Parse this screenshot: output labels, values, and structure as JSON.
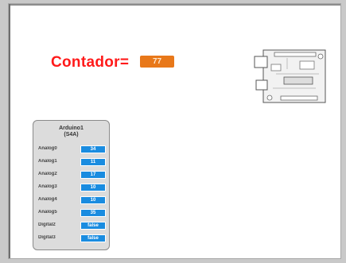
{
  "stage": {
    "counter": {
      "label": "Contador=",
      "value": "77"
    }
  },
  "arduino_panel": {
    "title_line1": "Arduino1",
    "title_line2": "(S4A)",
    "rows": [
      {
        "label": "Analog0",
        "value": "34",
        "type": "analog"
      },
      {
        "label": "Analog1",
        "value": "11",
        "type": "analog"
      },
      {
        "label": "Analog2",
        "value": "17",
        "type": "analog"
      },
      {
        "label": "Analog3",
        "value": "10",
        "type": "analog"
      },
      {
        "label": "Analog4",
        "value": "10",
        "type": "analog"
      },
      {
        "label": "Analog5",
        "value": "35",
        "type": "analog"
      },
      {
        "label": "Digital2",
        "value": "false",
        "type": "digital"
      },
      {
        "label": "Digital3",
        "value": "false",
        "type": "digital"
      }
    ]
  },
  "colors": {
    "counter_label": "#ff1a1a",
    "counter_value_bg": "#e8781a",
    "pin_value_bg": "#1a8ce0",
    "panel_bg": "#dcdcdc"
  },
  "icons": {
    "board": "arduino-board-icon"
  }
}
